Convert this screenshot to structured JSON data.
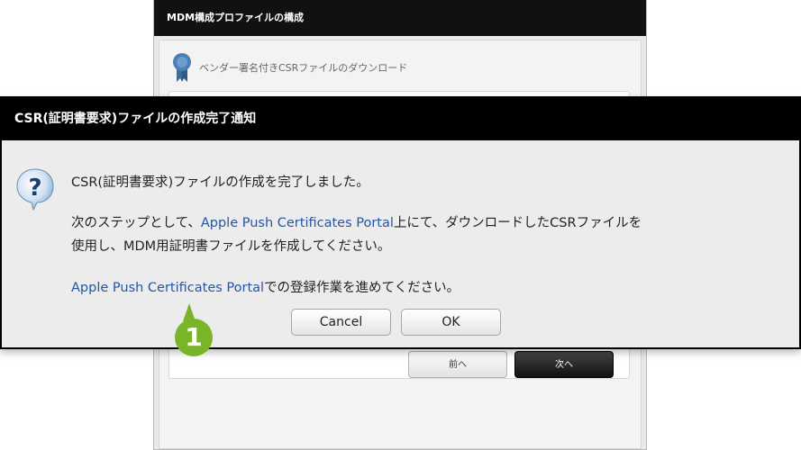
{
  "background_dialog": {
    "title": "MDM構成プロファイルの構成",
    "step_label": "ベンダー署名付きCSRファイルのダウンロード",
    "prev_button": "前へ",
    "next_button": "次へ"
  },
  "dialog": {
    "title": "CSR(証明書要求)ファイルの作成完了通知",
    "icon": "question-icon",
    "message_line1": "CSR(証明書要求)ファイルの作成を完了しました。",
    "message_line2_before": "次のステップとして、",
    "message_line2_link": "Apple Push Certificates Portal",
    "message_line2_after": "上にて、ダウンロードしたCSRファイルを",
    "message_line3": "使用し、MDM用証明書ファイルを作成してください。",
    "message_line4_link": "Apple Push Certificates Portal",
    "message_line4_after": "での登録作業を進めてください。",
    "cancel_button": "Cancel",
    "ok_button": "OK"
  },
  "callout": {
    "number": "1",
    "color": "#7ab428"
  },
  "colors": {
    "titlebar": "#000000",
    "link": "#2456a4",
    "dialog_bg": "#ececec"
  }
}
